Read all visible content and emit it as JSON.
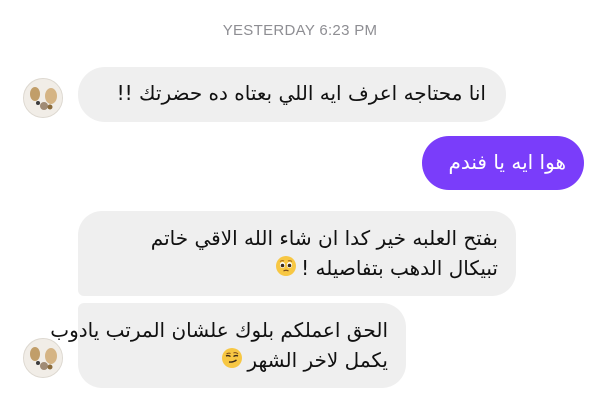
{
  "timestamp": "YESTERDAY 6:23 PM",
  "messages": [
    {
      "direction": "incoming",
      "lines": [
        "انا محتاجه اعرف ايه اللي بعتاه ده حضرتك !!"
      ]
    },
    {
      "direction": "outgoing",
      "lines": [
        "هوا ايه يا فندم"
      ]
    },
    {
      "direction": "incoming",
      "lines": [
        "بفتح العلبه خير كدا ان شاء الله الاقي خاتم",
        "تبيكال الدهب بتفاصيله !"
      ],
      "emoji": "pleading-face"
    },
    {
      "direction": "incoming",
      "lines": [
        "الحق اعملكم بلوك علشان المرتب يادوب",
        "يكمل لاخر الشهر"
      ],
      "emoji": "smirking-face"
    }
  ],
  "colors": {
    "outgoing_bubble": "#7a3dfa",
    "incoming_bubble": "#efefef",
    "timestamp_text": "#8e8e93"
  }
}
